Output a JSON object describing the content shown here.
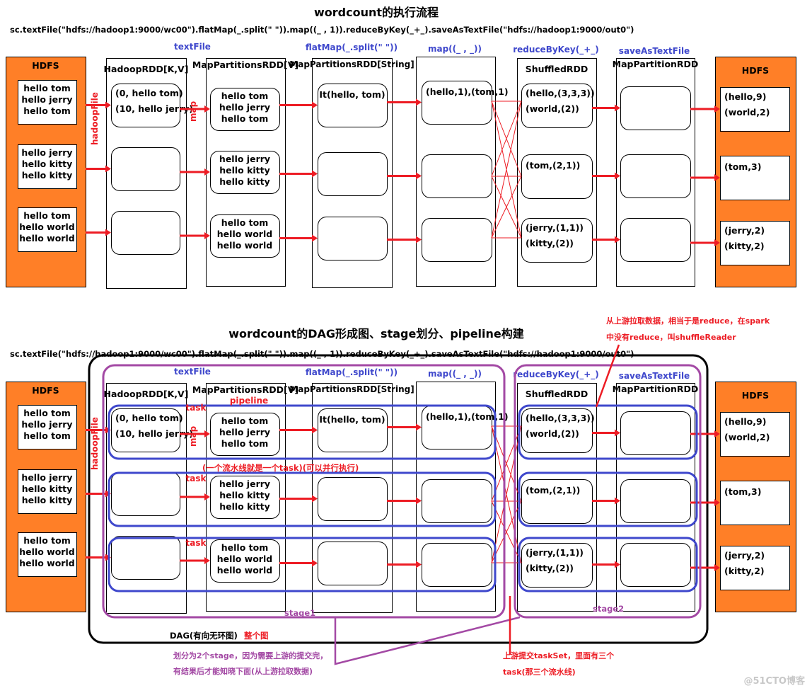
{
  "colors": {
    "hdfs": "#ff7f27",
    "arrow": "#ed1c24",
    "op_label": "#3f48cc",
    "stage": "#a349a4",
    "task_oval": "#3f48cc",
    "note_red": "#ed1c24",
    "note_purple": "#a349a4"
  },
  "diagrams": [
    {
      "title": "wordcount的执行流程",
      "code": "sc.textFile(\"hdfs://hadoop1:9000/wc00\").flatMap(_.split(\" \")).map((_ , 1)).reduceByKey(_+_).saveAsTextFile(\"hdfs://hadoop1:9000/out0\")",
      "ops": [
        "textFile",
        "flatMap(_.split(\" \"))",
        "map((_ , _))",
        "reduceByKey(_+_)",
        "saveAsTextFile"
      ],
      "edge_labels": [
        "hadoopFile",
        "map"
      ]
    },
    {
      "title": "wordcount的DAG形成图、stage划分、pipeline构建",
      "code": "sc.textFile(\"hdfs://hadoop1:9000/wc00\").flatMap(_.split(\" \")).map((_ , 1)).reduceByKey(_+_).saveAsTextFile(\"hdfs://hadoop1:9000/out0\")",
      "ops": [
        "textFile",
        "flatMap(_.split(\" \"))",
        "map((_ , _))",
        "reduceByKey(_+_)",
        "saveAsTextFile"
      ],
      "edge_labels": [
        "hadoopFile",
        "map"
      ]
    }
  ],
  "columns": [
    {
      "label": "HDFS",
      "cells": [
        [
          "hello tom",
          "hello jerry",
          "hello tom"
        ],
        [
          "hello  jerry",
          "hello  kitty",
          "hello kitty"
        ],
        [
          "hello tom",
          "hello world",
          "hello world"
        ]
      ]
    },
    {
      "label": "HadoopRDD[K,V]",
      "cells": [
        [
          "(0, hello tom)",
          "(10, hello jerry)"
        ],
        [],
        []
      ]
    },
    {
      "label": "MapPartitionsRDD[V]",
      "cells": [
        [
          "hello tom",
          "hello jerry",
          "hello tom"
        ],
        [
          "hello  jerry",
          "hello  kitty",
          "hello kitty"
        ],
        [
          "hello tom",
          "hello world",
          "hello world"
        ]
      ]
    },
    {
      "label": "MapPartitionsRDD[String]",
      "cells": [
        [
          "It(hello, tom)"
        ],
        [],
        []
      ]
    },
    {
      "label": "",
      "cells": [
        [
          "(hello,1),(tom,1)"
        ],
        [],
        []
      ]
    },
    {
      "label": "ShuffledRDD",
      "cells": [
        [
          "(hello,(3,3,3))",
          "(world,(2))"
        ],
        [
          "(tom,(2,1))"
        ],
        [
          "(jerry,(1,1))",
          "(kitty,(2))"
        ]
      ]
    },
    {
      "label": "MapPartitionRDD",
      "cells": [
        [],
        [],
        []
      ]
    },
    {
      "label": "HDFS",
      "cells": [
        [
          "(hello,9)",
          "(world,2)"
        ],
        [
          "(tom,3)"
        ],
        [
          "(jerry,2)",
          "(kitty,2)"
        ]
      ]
    }
  ],
  "dag_annotations": {
    "task_labels": [
      "task",
      "task",
      "task"
    ],
    "pipeline": "pipeline",
    "pipeline_note": "(一个流水线就是一个task)(可以并行执行)",
    "stage1": "stage1",
    "stage2": "stage2",
    "dag_label": "DAG(有向无环图)",
    "dag_label_red": "整个图",
    "stage_note": [
      "划分为2个stage，因为需要上游的提交完，",
      "有结果后才能知晓下面(从上游拉取数据)"
    ],
    "taskset_note": [
      "上游提交taskSet，里面有三个",
      "task(那三个流水线)"
    ],
    "shuffle_reader_note": [
      "从上游拉取数据，相当于是reduce，在spark",
      "中没有reduce，叫shuffleReader"
    ]
  },
  "watermark": "@51CTO博客"
}
